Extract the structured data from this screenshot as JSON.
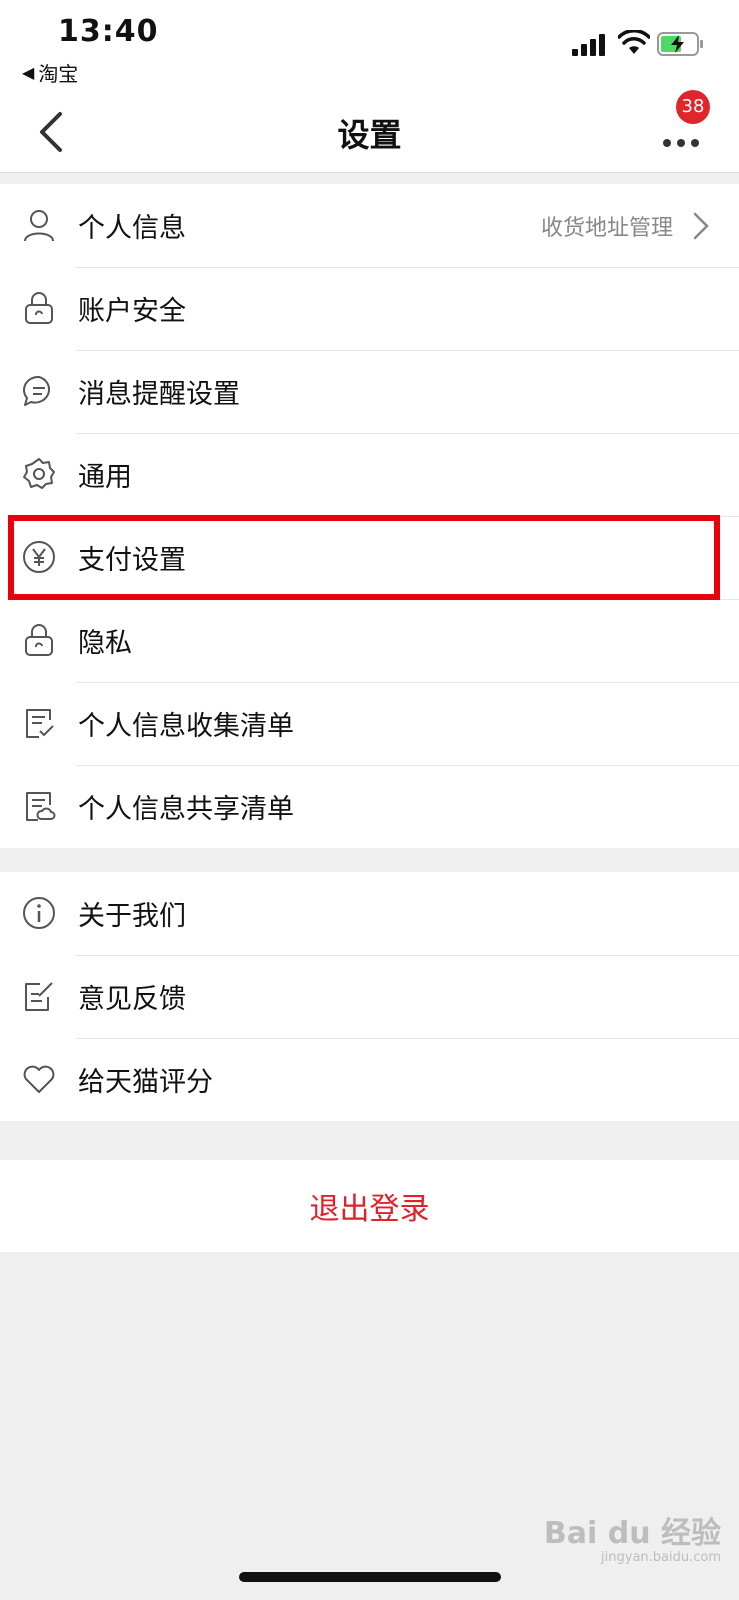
{
  "status_bar": {
    "time": "13:40",
    "back_app": "淘宝"
  },
  "nav": {
    "title": "设置",
    "badge_count": "38"
  },
  "group1": [
    {
      "icon": "user-icon",
      "label": "个人信息",
      "right": "收货地址管理"
    },
    {
      "icon": "lock-icon",
      "label": "账户安全"
    },
    {
      "icon": "message-bubble-icon",
      "label": "消息提醒设置"
    },
    {
      "icon": "gear-icon",
      "label": "通用"
    },
    {
      "icon": "yen-circle-icon",
      "label": "支付设置"
    },
    {
      "icon": "lock-icon",
      "label": "隐私"
    },
    {
      "icon": "checklist-icon",
      "label": "个人信息收集清单"
    },
    {
      "icon": "share-list-icon",
      "label": "个人信息共享清单"
    }
  ],
  "group2": [
    {
      "icon": "info-icon",
      "label": "关于我们"
    },
    {
      "icon": "feedback-icon",
      "label": "意见反馈"
    },
    {
      "icon": "heart-icon",
      "label": "给天猫评分"
    }
  ],
  "logout_label": "退出登录",
  "watermark": {
    "main": "Bai du 经验",
    "sub": "jingyan.baidu.com"
  },
  "colors": {
    "accent_red": "#e0202a",
    "highlight_red": "#e8000b",
    "background": "#efefef"
  }
}
